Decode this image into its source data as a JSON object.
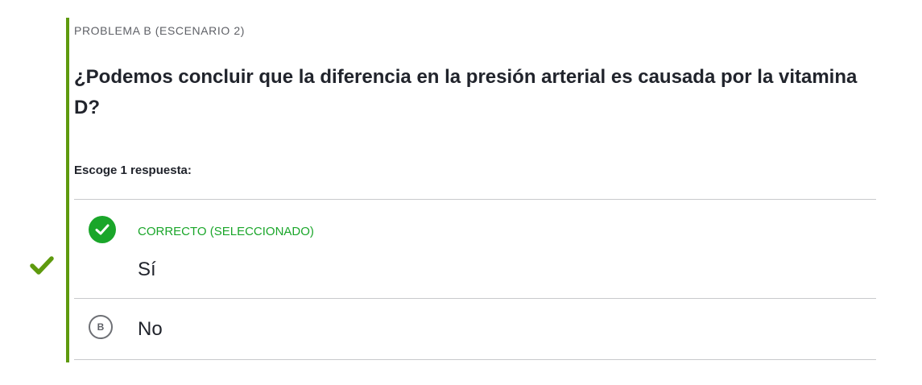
{
  "problem": {
    "eyebrow": "PROBLEMA B (ESCENARIO 2)",
    "question": "¿Podemos concluir que la diferencia en la presión arterial es causada por la vitamina D?",
    "instruction": "Escoge 1 respuesta:"
  },
  "choices": [
    {
      "status_label": "CORRECTO (SELECCIONADO)",
      "text": "Sí",
      "icon": "check-circle-icon"
    },
    {
      "letter": "B",
      "text": "No",
      "icon": "letter-circle-icon"
    }
  ],
  "colors": {
    "accent_bar": "#5e9a0e",
    "correct_green": "#1aa62a",
    "divider": "#c8c9cc"
  },
  "result_icon": "checkmark-icon"
}
